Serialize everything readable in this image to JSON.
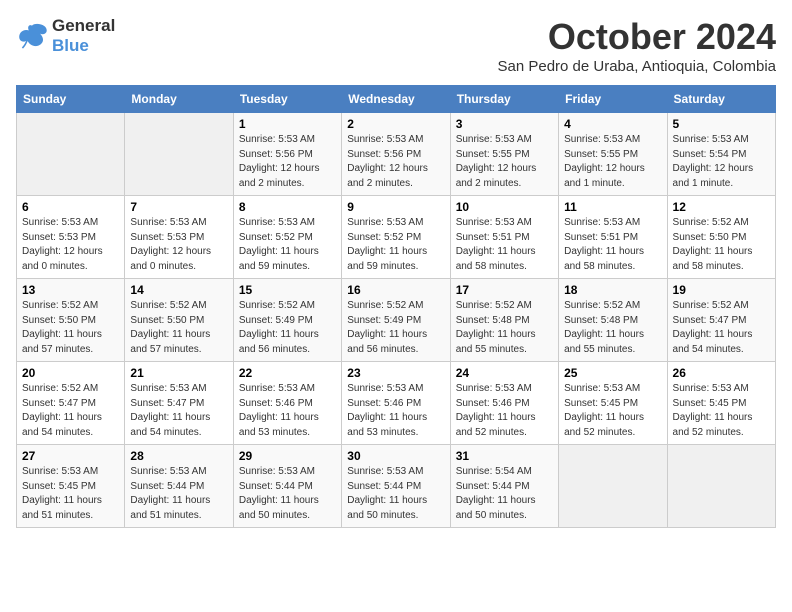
{
  "logo": {
    "line1": "General",
    "line2": "Blue"
  },
  "title": "October 2024",
  "subtitle": "San Pedro de Uraba, Antioquia, Colombia",
  "weekdays": [
    "Sunday",
    "Monday",
    "Tuesday",
    "Wednesday",
    "Thursday",
    "Friday",
    "Saturday"
  ],
  "weeks": [
    [
      {
        "day": "",
        "details": ""
      },
      {
        "day": "",
        "details": ""
      },
      {
        "day": "1",
        "details": "Sunrise: 5:53 AM\nSunset: 5:56 PM\nDaylight: 12 hours\nand 2 minutes."
      },
      {
        "day": "2",
        "details": "Sunrise: 5:53 AM\nSunset: 5:56 PM\nDaylight: 12 hours\nand 2 minutes."
      },
      {
        "day": "3",
        "details": "Sunrise: 5:53 AM\nSunset: 5:55 PM\nDaylight: 12 hours\nand 2 minutes."
      },
      {
        "day": "4",
        "details": "Sunrise: 5:53 AM\nSunset: 5:55 PM\nDaylight: 12 hours\nand 1 minute."
      },
      {
        "day": "5",
        "details": "Sunrise: 5:53 AM\nSunset: 5:54 PM\nDaylight: 12 hours\nand 1 minute."
      }
    ],
    [
      {
        "day": "6",
        "details": "Sunrise: 5:53 AM\nSunset: 5:53 PM\nDaylight: 12 hours\nand 0 minutes."
      },
      {
        "day": "7",
        "details": "Sunrise: 5:53 AM\nSunset: 5:53 PM\nDaylight: 12 hours\nand 0 minutes."
      },
      {
        "day": "8",
        "details": "Sunrise: 5:53 AM\nSunset: 5:52 PM\nDaylight: 11 hours\nand 59 minutes."
      },
      {
        "day": "9",
        "details": "Sunrise: 5:53 AM\nSunset: 5:52 PM\nDaylight: 11 hours\nand 59 minutes."
      },
      {
        "day": "10",
        "details": "Sunrise: 5:53 AM\nSunset: 5:51 PM\nDaylight: 11 hours\nand 58 minutes."
      },
      {
        "day": "11",
        "details": "Sunrise: 5:53 AM\nSunset: 5:51 PM\nDaylight: 11 hours\nand 58 minutes."
      },
      {
        "day": "12",
        "details": "Sunrise: 5:52 AM\nSunset: 5:50 PM\nDaylight: 11 hours\nand 58 minutes."
      }
    ],
    [
      {
        "day": "13",
        "details": "Sunrise: 5:52 AM\nSunset: 5:50 PM\nDaylight: 11 hours\nand 57 minutes."
      },
      {
        "day": "14",
        "details": "Sunrise: 5:52 AM\nSunset: 5:50 PM\nDaylight: 11 hours\nand 57 minutes."
      },
      {
        "day": "15",
        "details": "Sunrise: 5:52 AM\nSunset: 5:49 PM\nDaylight: 11 hours\nand 56 minutes."
      },
      {
        "day": "16",
        "details": "Sunrise: 5:52 AM\nSunset: 5:49 PM\nDaylight: 11 hours\nand 56 minutes."
      },
      {
        "day": "17",
        "details": "Sunrise: 5:52 AM\nSunset: 5:48 PM\nDaylight: 11 hours\nand 55 minutes."
      },
      {
        "day": "18",
        "details": "Sunrise: 5:52 AM\nSunset: 5:48 PM\nDaylight: 11 hours\nand 55 minutes."
      },
      {
        "day": "19",
        "details": "Sunrise: 5:52 AM\nSunset: 5:47 PM\nDaylight: 11 hours\nand 54 minutes."
      }
    ],
    [
      {
        "day": "20",
        "details": "Sunrise: 5:52 AM\nSunset: 5:47 PM\nDaylight: 11 hours\nand 54 minutes."
      },
      {
        "day": "21",
        "details": "Sunrise: 5:53 AM\nSunset: 5:47 PM\nDaylight: 11 hours\nand 54 minutes."
      },
      {
        "day": "22",
        "details": "Sunrise: 5:53 AM\nSunset: 5:46 PM\nDaylight: 11 hours\nand 53 minutes."
      },
      {
        "day": "23",
        "details": "Sunrise: 5:53 AM\nSunset: 5:46 PM\nDaylight: 11 hours\nand 53 minutes."
      },
      {
        "day": "24",
        "details": "Sunrise: 5:53 AM\nSunset: 5:46 PM\nDaylight: 11 hours\nand 52 minutes."
      },
      {
        "day": "25",
        "details": "Sunrise: 5:53 AM\nSunset: 5:45 PM\nDaylight: 11 hours\nand 52 minutes."
      },
      {
        "day": "26",
        "details": "Sunrise: 5:53 AM\nSunset: 5:45 PM\nDaylight: 11 hours\nand 52 minutes."
      }
    ],
    [
      {
        "day": "27",
        "details": "Sunrise: 5:53 AM\nSunset: 5:45 PM\nDaylight: 11 hours\nand 51 minutes."
      },
      {
        "day": "28",
        "details": "Sunrise: 5:53 AM\nSunset: 5:44 PM\nDaylight: 11 hours\nand 51 minutes."
      },
      {
        "day": "29",
        "details": "Sunrise: 5:53 AM\nSunset: 5:44 PM\nDaylight: 11 hours\nand 50 minutes."
      },
      {
        "day": "30",
        "details": "Sunrise: 5:53 AM\nSunset: 5:44 PM\nDaylight: 11 hours\nand 50 minutes."
      },
      {
        "day": "31",
        "details": "Sunrise: 5:54 AM\nSunset: 5:44 PM\nDaylight: 11 hours\nand 50 minutes."
      },
      {
        "day": "",
        "details": ""
      },
      {
        "day": "",
        "details": ""
      }
    ]
  ]
}
